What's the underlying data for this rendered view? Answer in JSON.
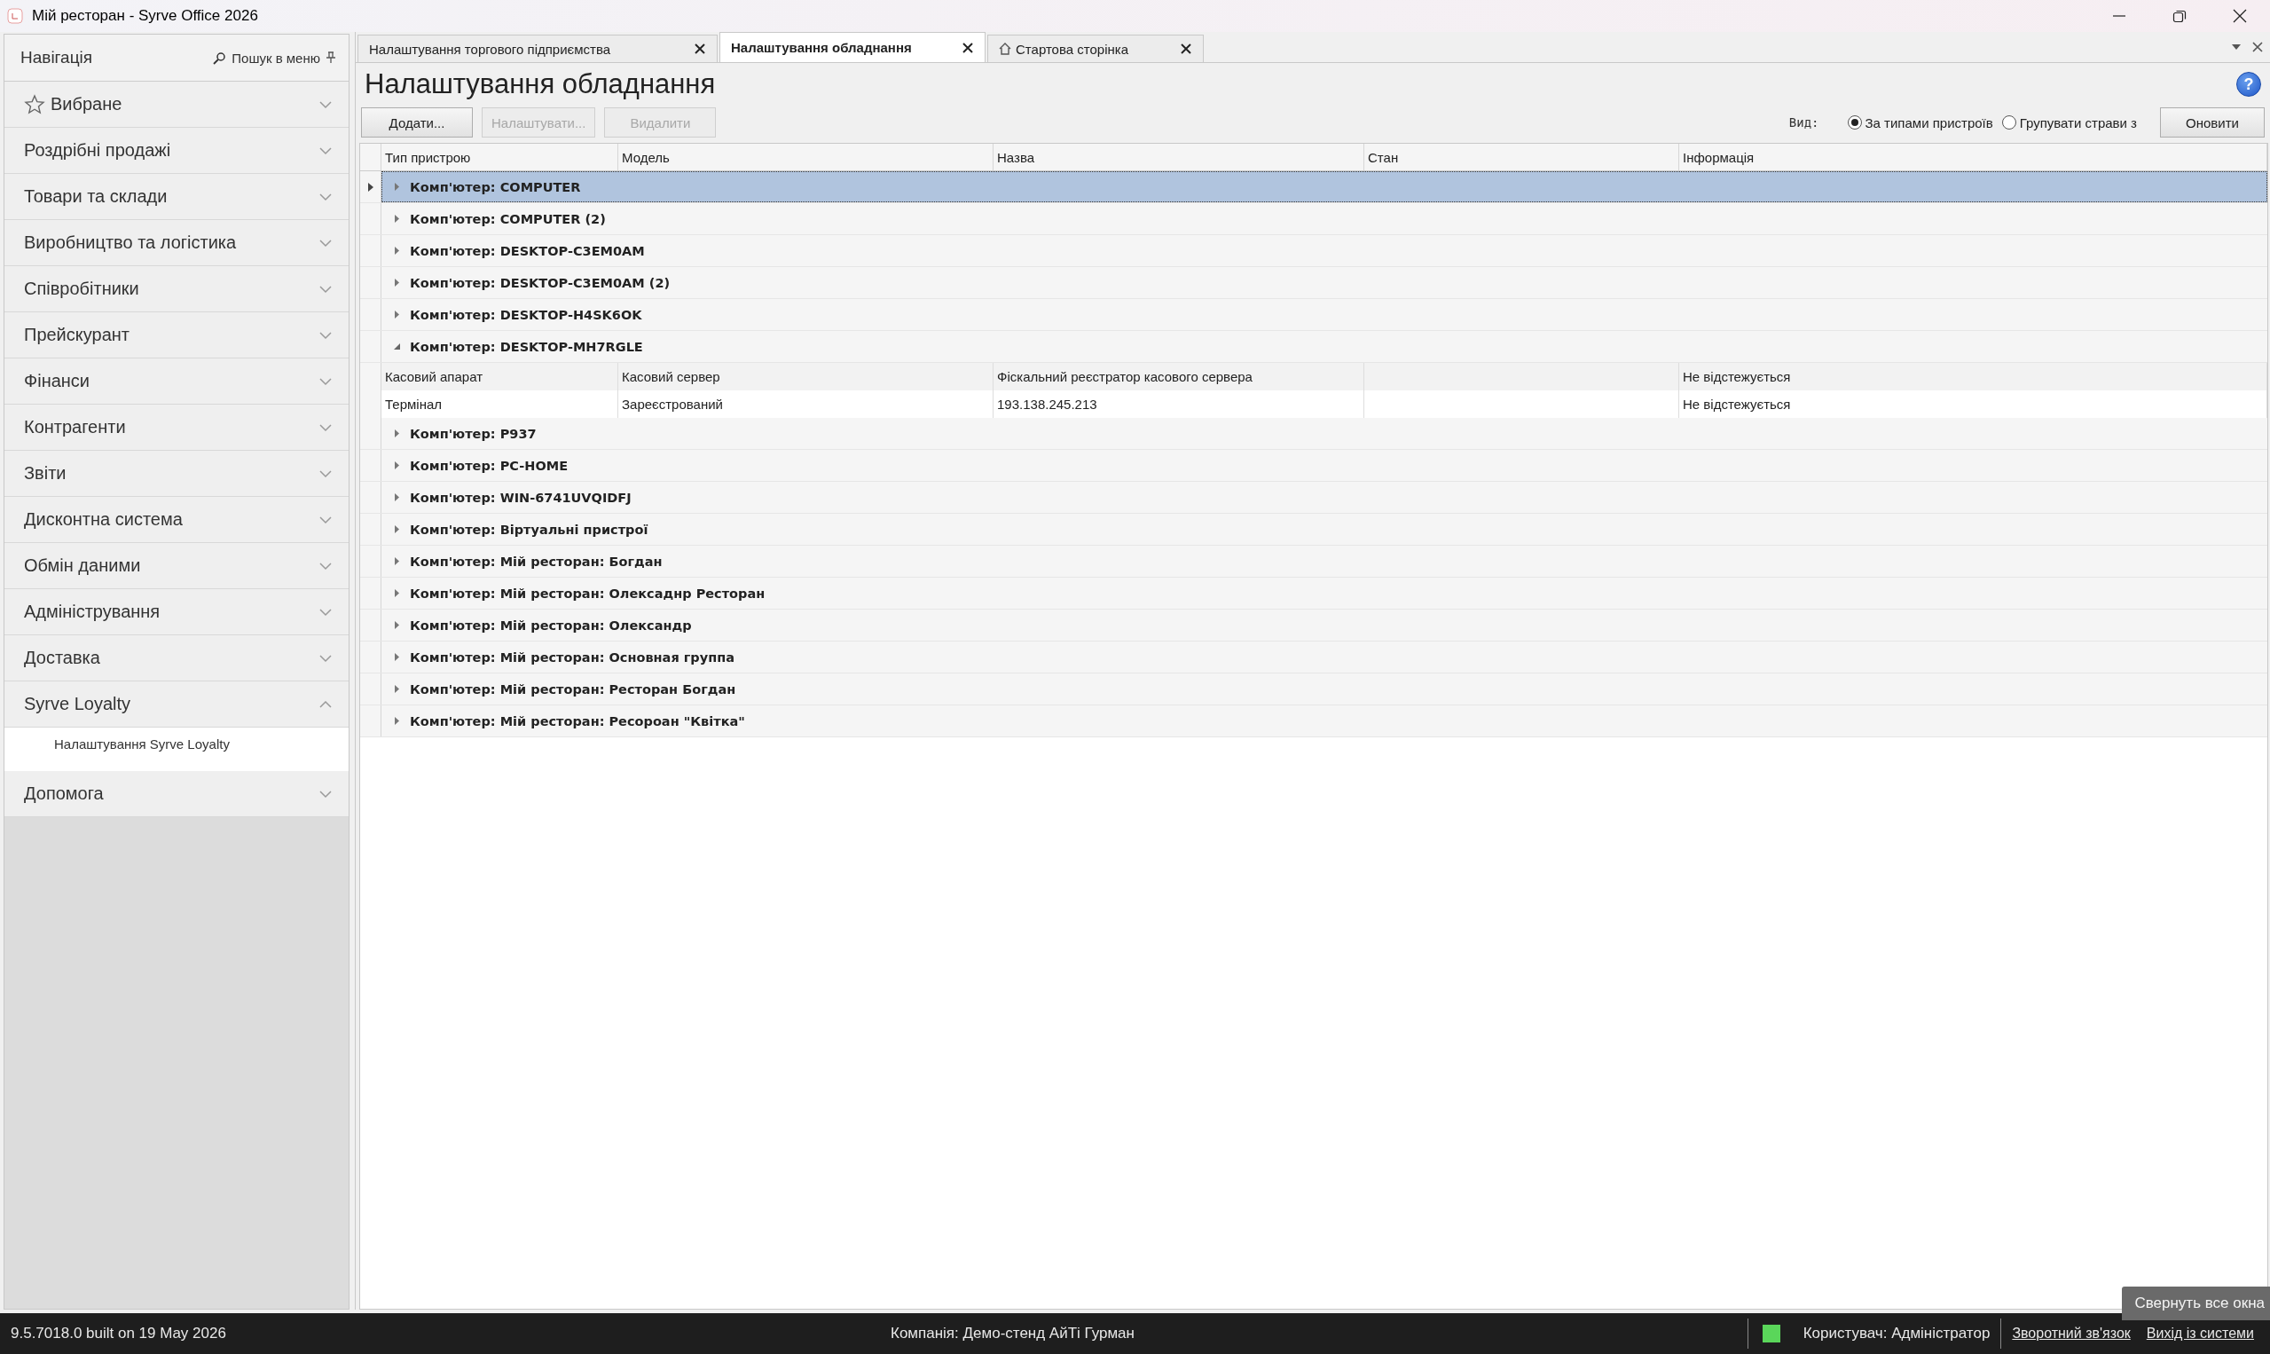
{
  "window": {
    "title": "Мій ресторан - Syrve Office 2026"
  },
  "sidebar": {
    "title": "Навігація",
    "search": "Пошук в меню",
    "items": [
      {
        "label": "Вибране",
        "kind": "favorites",
        "expanded": false
      },
      {
        "label": "Роздрібні продажі",
        "kind": "section",
        "expanded": false
      },
      {
        "label": "Товари та склади",
        "kind": "section",
        "expanded": false
      },
      {
        "label": "Виробництво та логістика",
        "kind": "section",
        "expanded": false
      },
      {
        "label": "Співробітники",
        "kind": "section",
        "expanded": false
      },
      {
        "label": "Прейскурант",
        "kind": "section",
        "expanded": false
      },
      {
        "label": "Фінанси",
        "kind": "section",
        "expanded": false
      },
      {
        "label": "Контрагенти",
        "kind": "section",
        "expanded": false
      },
      {
        "label": "Звіти",
        "kind": "section",
        "expanded": false
      },
      {
        "label": "Дисконтна система",
        "kind": "section",
        "expanded": false
      },
      {
        "label": "Обмін даними",
        "kind": "section",
        "expanded": false
      },
      {
        "label": "Адміністрування",
        "kind": "section",
        "expanded": false
      },
      {
        "label": "Доставка",
        "kind": "section",
        "expanded": false
      },
      {
        "label": "Syrve Loyalty",
        "kind": "section",
        "expanded": true,
        "children": [
          {
            "label": "Налаштування Syrve Loyalty"
          }
        ]
      },
      {
        "label": "Допомога",
        "kind": "section",
        "expanded": false
      }
    ]
  },
  "tabs": [
    {
      "label": "Налаштування торгового підприємства",
      "kind": "plain",
      "selected": false
    },
    {
      "label": "Налаштування обладнання",
      "kind": "plain",
      "selected": true
    },
    {
      "label": "Стартова сторінка",
      "kind": "home",
      "selected": false
    }
  ],
  "page": {
    "title": "Налаштування обладнання",
    "help": "?",
    "buttons": [
      {
        "label": "Додати...",
        "disabled": false
      },
      {
        "label": "Налаштувати...",
        "disabled": true
      },
      {
        "label": "Видалити",
        "disabled": true
      }
    ],
    "view_label": "Вид:",
    "view_options": [
      {
        "label": "За типами пристроїв",
        "selected": true
      },
      {
        "label": "Групувати страви з",
        "selected": false
      }
    ],
    "refresh": "Оновити"
  },
  "table": {
    "columns": [
      "Тип пристрою",
      "Модель",
      "Назва",
      "Стан",
      "Інформація"
    ],
    "groups": [
      {
        "label": "Комп'ютер: COMPUTER",
        "selected": true,
        "expanded": false
      },
      {
        "label": "Комп'ютер: COMPUTER (2)",
        "selected": false,
        "expanded": false
      },
      {
        "label": "Комп'ютер: DESKTOP-C3EM0AM",
        "selected": false,
        "expanded": false
      },
      {
        "label": "Комп'ютер: DESKTOP-C3EM0AM (2)",
        "selected": false,
        "expanded": false
      },
      {
        "label": "Комп'ютер: DESKTOP-H4SK6OK",
        "selected": false,
        "expanded": false
      },
      {
        "label": "Комп'ютер: DESKTOP-MH7RGLE",
        "selected": false,
        "expanded": true,
        "rows": [
          {
            "device_type": "Касовий апарат",
            "model": "Касовий сервер",
            "name": "Фіскальний реєстратор касового сервера",
            "info": "Не відстежується"
          },
          {
            "device_type": "Термінал",
            "model": "Зареєстрований",
            "name": "193.138.245.213",
            "info": "Не відстежується"
          }
        ]
      },
      {
        "label": "Комп'ютер: P937",
        "selected": false,
        "expanded": false
      },
      {
        "label": "Комп'ютер: PC-HOME",
        "selected": false,
        "expanded": false
      },
      {
        "label": "Комп'ютер: WIN-6741UVQIDFJ",
        "selected": false,
        "expanded": false
      },
      {
        "label": "Комп'ютер: Віртуальні пристрої",
        "selected": false,
        "expanded": false
      },
      {
        "label": "Комп'ютер: Мій ресторан: Богдан",
        "selected": false,
        "expanded": false
      },
      {
        "label": "Комп'ютер: Мій ресторан: Олексаднр Ресторан",
        "selected": false,
        "expanded": false
      },
      {
        "label": "Комп'ютер: Мій ресторан: Олександр",
        "selected": false,
        "expanded": false
      },
      {
        "label": "Комп'ютер: Мій ресторан: Основная группа",
        "selected": false,
        "expanded": false
      },
      {
        "label": "Комп'ютер: Мій ресторан: Ресторан Богдан",
        "selected": false,
        "expanded": false
      },
      {
        "label": "Комп'ютер: Мій ресторан: Ресороан \"Квітка\"",
        "selected": false,
        "expanded": false
      }
    ]
  },
  "status_bar": {
    "version": "9.5.7018.0 built on 19 May 2026",
    "company": "Компанія: Демо-стенд АйТі Гурман",
    "user": "Користувач: Адміністратор",
    "links": [
      "Зворотний зв'язок",
      "Вихід із системи"
    ]
  },
  "overlay_button": "Свернуть все окна"
}
